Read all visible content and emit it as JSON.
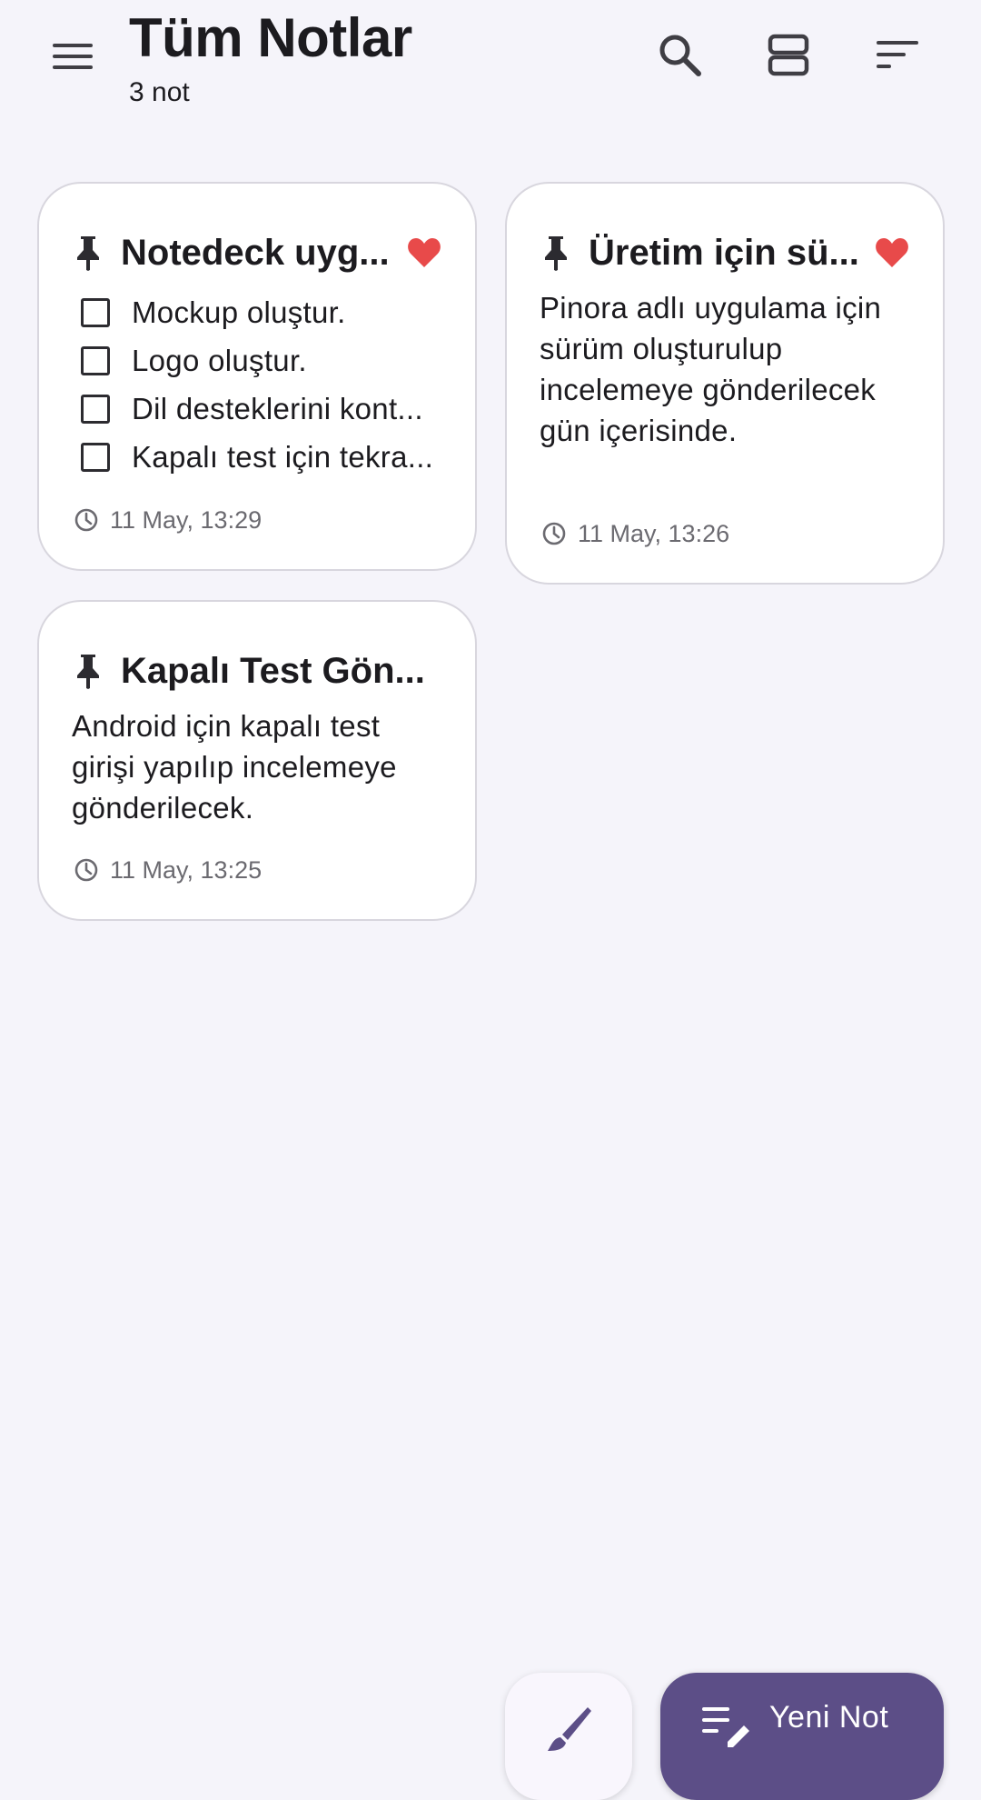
{
  "header": {
    "title": "Tüm Notlar",
    "subtitle": "3 not",
    "menu_icon": "menu-icon",
    "search_icon": "search-icon",
    "view_icon": "view-agenda-icon",
    "sort_icon": "sort-icon"
  },
  "colors": {
    "background": "#F5F4FA",
    "card": "#FFFFFF",
    "accent": "#5C4E87",
    "favorite": "#E84A4A"
  },
  "notes": [
    {
      "title": "Notedeck uyg...",
      "pinned": true,
      "favorite": true,
      "checklist": [
        "Mockup oluştur.",
        "Logo oluştur.",
        "Dil desteklerini kont...",
        "Kapalı test için tekra..."
      ],
      "timestamp": "11 May, 13:29"
    },
    {
      "title": "Üretim için sü...",
      "pinned": true,
      "favorite": true,
      "body": "Pinora adlı uygulama için sürüm oluşturulup incelemeye gönderilecek gün içerisinde.",
      "timestamp": "11 May, 13:26"
    },
    {
      "title": "Kapalı Test Gön...",
      "pinned": true,
      "favorite": false,
      "body": "Android için kapalı test girişi yapılıp incelemeye gönderilecek.",
      "timestamp": "11 May, 13:25"
    }
  ],
  "fab": {
    "draw_icon": "brush-icon",
    "new_note_icon": "edit-note-icon",
    "new_note_label": "Yeni Not"
  }
}
